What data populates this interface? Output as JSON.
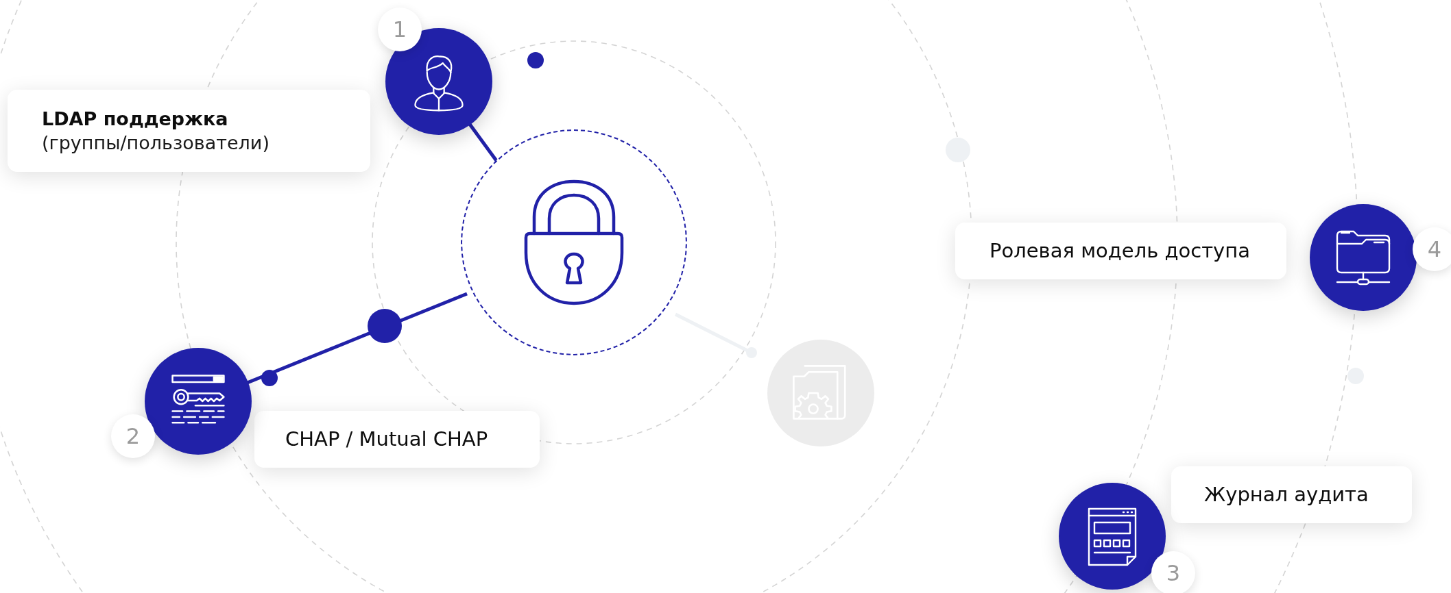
{
  "features": [
    {
      "number": "1",
      "kind": "user",
      "title": "LDAP поддержка",
      "subtitle": "(группы/пользователи)"
    },
    {
      "number": "4",
      "kind": "network",
      "title": "Ролевая модель доступа"
    },
    {
      "number": "2",
      "kind": "key",
      "title": "CHAP / Mutual CHAP"
    },
    {
      "number": "3",
      "kind": "audit",
      "title": "Журнал аудита"
    }
  ]
}
